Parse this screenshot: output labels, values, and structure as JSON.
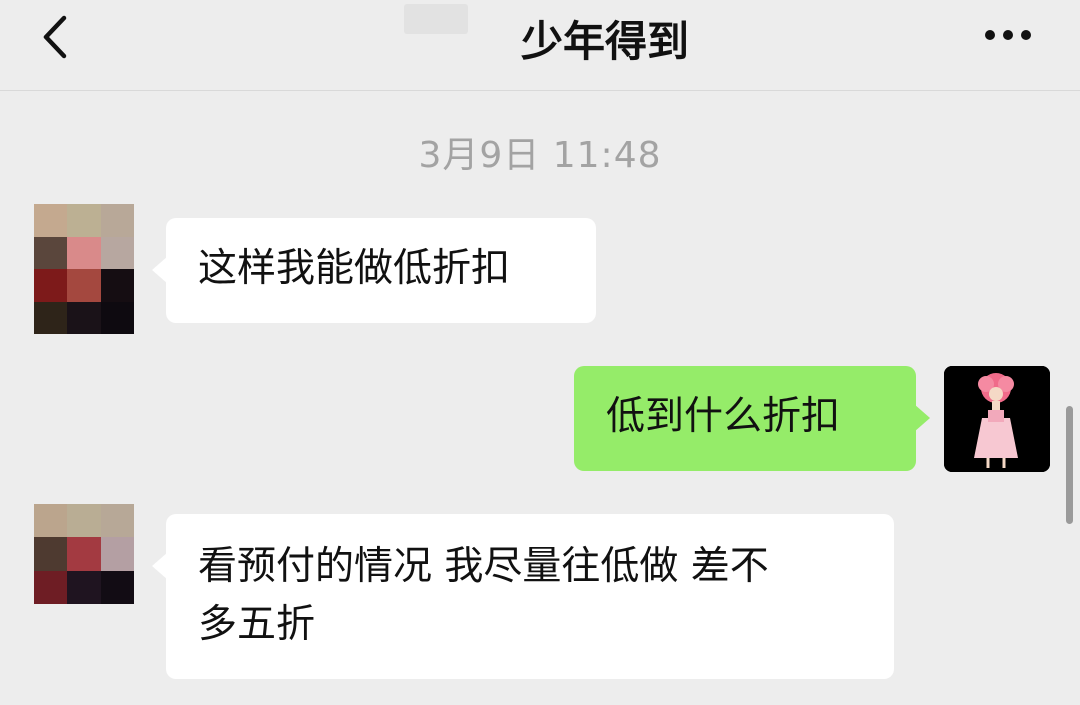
{
  "header": {
    "title": "少年得到",
    "back_icon": "chevron-left-icon",
    "more_icon": "more-dots-icon"
  },
  "timestamp": "3月9日 11:48",
  "messages": [
    {
      "side": "left",
      "text": "这样我能做低折扣"
    },
    {
      "side": "right",
      "text": "低到什么折扣"
    },
    {
      "side": "left",
      "text_line1": "看预付的情况 我尽量往低做 差不",
      "text_line2": "多五折"
    }
  ],
  "colors": {
    "background": "#ededed",
    "incoming_bubble": "#ffffff",
    "outgoing_bubble": "#95ec69",
    "timestamp": "#a3a3a3"
  }
}
